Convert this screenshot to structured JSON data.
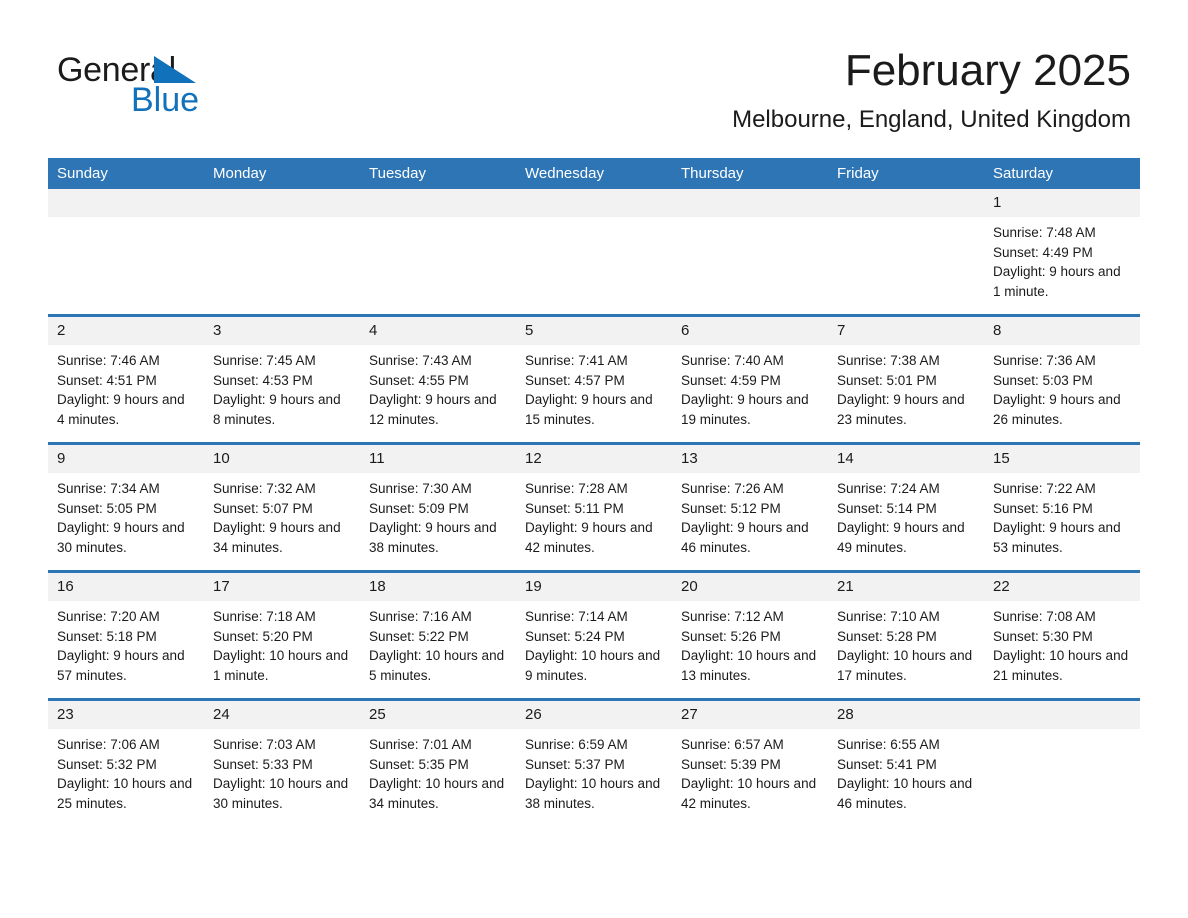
{
  "logo": {
    "word_one": "General",
    "word_two": "Blue",
    "triangle": "triangle-mark",
    "brand_blue": "#1271bb"
  },
  "header": {
    "month_title": "February 2025",
    "location": "Melbourne, England, United Kingdom"
  },
  "colors": {
    "header_blue": "#2e75b6",
    "daynum_band": "#f2f2f2",
    "text": "#1b1b1b"
  },
  "calendar": {
    "weekday_headers": [
      "Sunday",
      "Monday",
      "Tuesday",
      "Wednesday",
      "Thursday",
      "Friday",
      "Saturday"
    ],
    "weeks": [
      [
        {
          "day": "",
          "empty": true
        },
        {
          "day": "",
          "empty": true
        },
        {
          "day": "",
          "empty": true
        },
        {
          "day": "",
          "empty": true
        },
        {
          "day": "",
          "empty": true
        },
        {
          "day": "",
          "empty": true
        },
        {
          "day": "1",
          "sunrise": "Sunrise: 7:48 AM",
          "sunset": "Sunset: 4:49 PM",
          "daylight": "Daylight: 9 hours and 1 minute."
        }
      ],
      [
        {
          "day": "2",
          "sunrise": "Sunrise: 7:46 AM",
          "sunset": "Sunset: 4:51 PM",
          "daylight": "Daylight: 9 hours and 4 minutes."
        },
        {
          "day": "3",
          "sunrise": "Sunrise: 7:45 AM",
          "sunset": "Sunset: 4:53 PM",
          "daylight": "Daylight: 9 hours and 8 minutes."
        },
        {
          "day": "4",
          "sunrise": "Sunrise: 7:43 AM",
          "sunset": "Sunset: 4:55 PM",
          "daylight": "Daylight: 9 hours and 12 minutes."
        },
        {
          "day": "5",
          "sunrise": "Sunrise: 7:41 AM",
          "sunset": "Sunset: 4:57 PM",
          "daylight": "Daylight: 9 hours and 15 minutes."
        },
        {
          "day": "6",
          "sunrise": "Sunrise: 7:40 AM",
          "sunset": "Sunset: 4:59 PM",
          "daylight": "Daylight: 9 hours and 19 minutes."
        },
        {
          "day": "7",
          "sunrise": "Sunrise: 7:38 AM",
          "sunset": "Sunset: 5:01 PM",
          "daylight": "Daylight: 9 hours and 23 minutes."
        },
        {
          "day": "8",
          "sunrise": "Sunrise: 7:36 AM",
          "sunset": "Sunset: 5:03 PM",
          "daylight": "Daylight: 9 hours and 26 minutes."
        }
      ],
      [
        {
          "day": "9",
          "sunrise": "Sunrise: 7:34 AM",
          "sunset": "Sunset: 5:05 PM",
          "daylight": "Daylight: 9 hours and 30 minutes."
        },
        {
          "day": "10",
          "sunrise": "Sunrise: 7:32 AM",
          "sunset": "Sunset: 5:07 PM",
          "daylight": "Daylight: 9 hours and 34 minutes."
        },
        {
          "day": "11",
          "sunrise": "Sunrise: 7:30 AM",
          "sunset": "Sunset: 5:09 PM",
          "daylight": "Daylight: 9 hours and 38 minutes."
        },
        {
          "day": "12",
          "sunrise": "Sunrise: 7:28 AM",
          "sunset": "Sunset: 5:11 PM",
          "daylight": "Daylight: 9 hours and 42 minutes."
        },
        {
          "day": "13",
          "sunrise": "Sunrise: 7:26 AM",
          "sunset": "Sunset: 5:12 PM",
          "daylight": "Daylight: 9 hours and 46 minutes."
        },
        {
          "day": "14",
          "sunrise": "Sunrise: 7:24 AM",
          "sunset": "Sunset: 5:14 PM",
          "daylight": "Daylight: 9 hours and 49 minutes."
        },
        {
          "day": "15",
          "sunrise": "Sunrise: 7:22 AM",
          "sunset": "Sunset: 5:16 PM",
          "daylight": "Daylight: 9 hours and 53 minutes."
        }
      ],
      [
        {
          "day": "16",
          "sunrise": "Sunrise: 7:20 AM",
          "sunset": "Sunset: 5:18 PM",
          "daylight": "Daylight: 9 hours and 57 minutes."
        },
        {
          "day": "17",
          "sunrise": "Sunrise: 7:18 AM",
          "sunset": "Sunset: 5:20 PM",
          "daylight": "Daylight: 10 hours and 1 minute."
        },
        {
          "day": "18",
          "sunrise": "Sunrise: 7:16 AM",
          "sunset": "Sunset: 5:22 PM",
          "daylight": "Daylight: 10 hours and 5 minutes."
        },
        {
          "day": "19",
          "sunrise": "Sunrise: 7:14 AM",
          "sunset": "Sunset: 5:24 PM",
          "daylight": "Daylight: 10 hours and 9 minutes."
        },
        {
          "day": "20",
          "sunrise": "Sunrise: 7:12 AM",
          "sunset": "Sunset: 5:26 PM",
          "daylight": "Daylight: 10 hours and 13 minutes."
        },
        {
          "day": "21",
          "sunrise": "Sunrise: 7:10 AM",
          "sunset": "Sunset: 5:28 PM",
          "daylight": "Daylight: 10 hours and 17 minutes."
        },
        {
          "day": "22",
          "sunrise": "Sunrise: 7:08 AM",
          "sunset": "Sunset: 5:30 PM",
          "daylight": "Daylight: 10 hours and 21 minutes."
        }
      ],
      [
        {
          "day": "23",
          "sunrise": "Sunrise: 7:06 AM",
          "sunset": "Sunset: 5:32 PM",
          "daylight": "Daylight: 10 hours and 25 minutes."
        },
        {
          "day": "24",
          "sunrise": "Sunrise: 7:03 AM",
          "sunset": "Sunset: 5:33 PM",
          "daylight": "Daylight: 10 hours and 30 minutes."
        },
        {
          "day": "25",
          "sunrise": "Sunrise: 7:01 AM",
          "sunset": "Sunset: 5:35 PM",
          "daylight": "Daylight: 10 hours and 34 minutes."
        },
        {
          "day": "26",
          "sunrise": "Sunrise: 6:59 AM",
          "sunset": "Sunset: 5:37 PM",
          "daylight": "Daylight: 10 hours and 38 minutes."
        },
        {
          "day": "27",
          "sunrise": "Sunrise: 6:57 AM",
          "sunset": "Sunset: 5:39 PM",
          "daylight": "Daylight: 10 hours and 42 minutes."
        },
        {
          "day": "28",
          "sunrise": "Sunrise: 6:55 AM",
          "sunset": "Sunset: 5:41 PM",
          "daylight": "Daylight: 10 hours and 46 minutes."
        },
        {
          "day": "",
          "empty": true
        }
      ]
    ]
  }
}
